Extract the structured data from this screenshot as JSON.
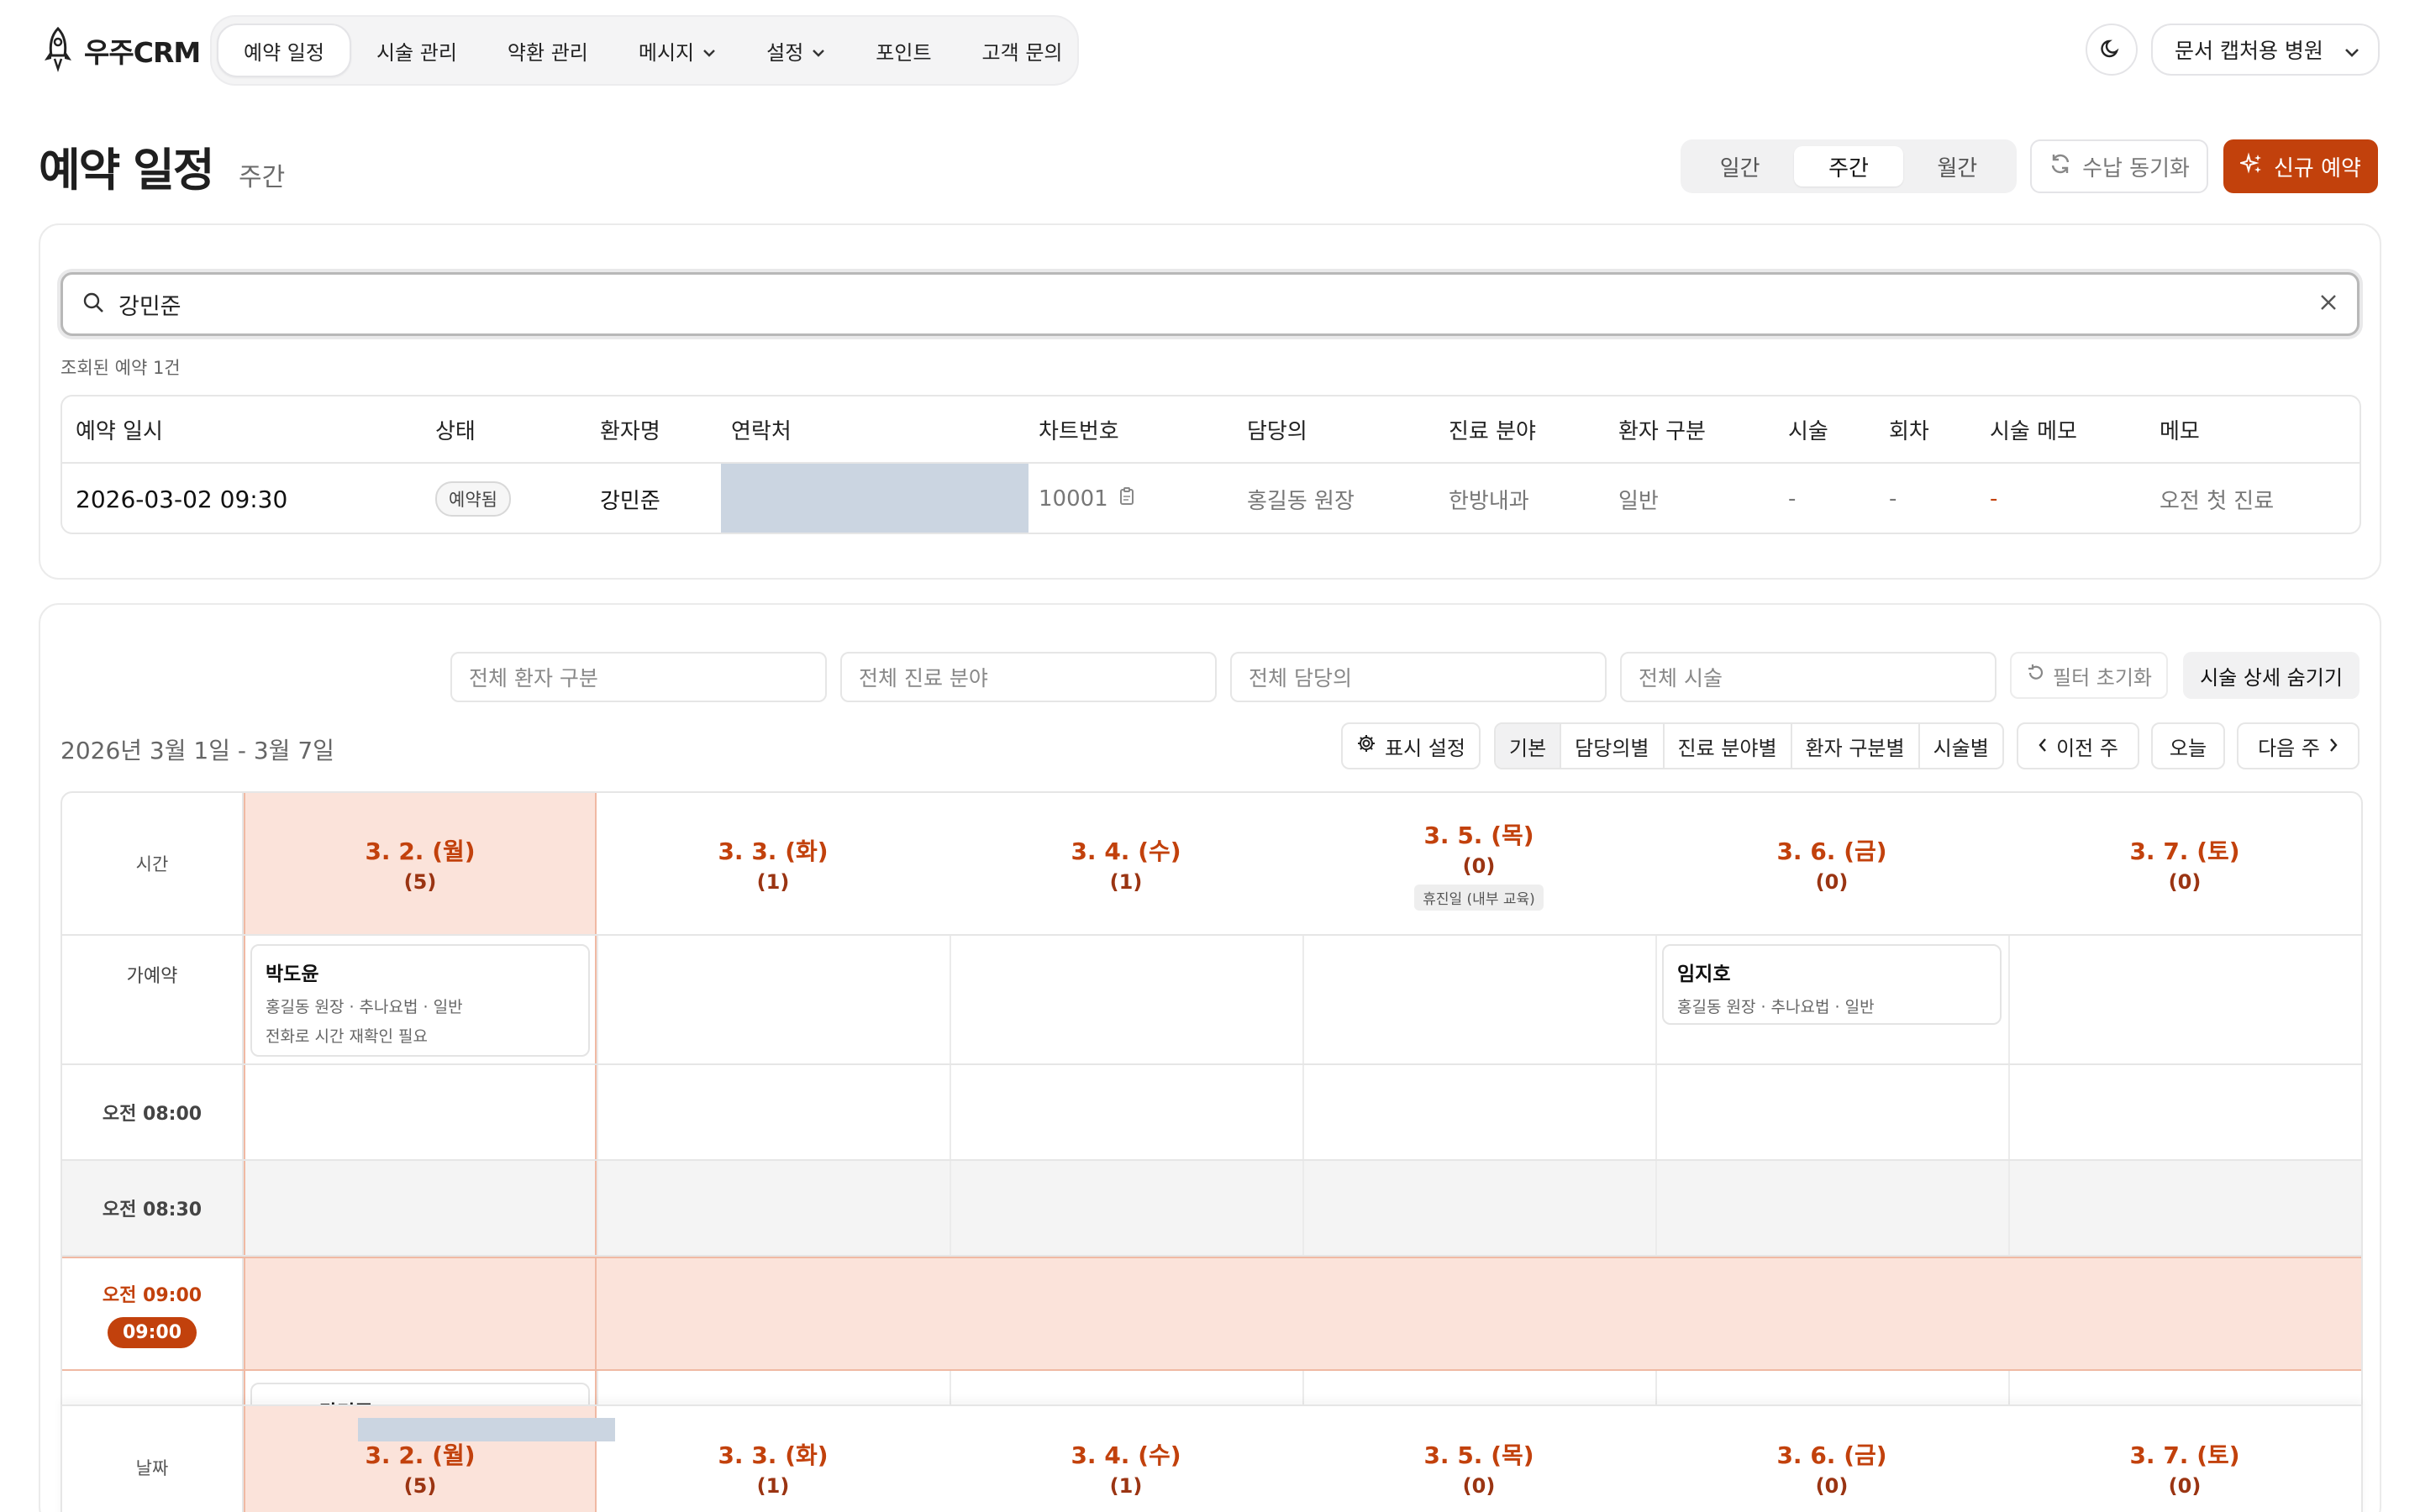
{
  "app": {
    "name": "우주CRM"
  },
  "nav": {
    "items": [
      {
        "label": "예약 일정",
        "active": true,
        "dropdown": false
      },
      {
        "label": "시술 관리",
        "active": false,
        "dropdown": false
      },
      {
        "label": "약환 관리",
        "active": false,
        "dropdown": false
      },
      {
        "label": "메시지",
        "active": false,
        "dropdown": true
      },
      {
        "label": "설정",
        "active": false,
        "dropdown": true
      },
      {
        "label": "포인트",
        "active": false,
        "dropdown": false
      },
      {
        "label": "고객 문의",
        "active": false,
        "dropdown": false
      }
    ],
    "clinic": "문서 캡처용 병원"
  },
  "header": {
    "title": "예약 일정",
    "subtitle": "주간",
    "views": [
      "일간",
      "주간",
      "월간"
    ],
    "active_view": "주간",
    "sync_label": "수납 동기화",
    "new_label": "신규 예약"
  },
  "search": {
    "value": "강민준",
    "result_count": "조회된 예약 1건",
    "columns": [
      "예약 일시",
      "상태",
      "환자명",
      "연락처",
      "차트번호",
      "담당의",
      "진료 분야",
      "환자 구분",
      "시술",
      "회차",
      "시술 메모",
      "메모"
    ],
    "row": {
      "datetime": "2026-03-02 09:30",
      "status": "예약됨",
      "patient": "강민준",
      "chart_no": "10001",
      "doctor": "홍길동 원장",
      "department": "한방내과",
      "patient_type": "일반",
      "procedure": "-",
      "session": "-",
      "procedure_memo": "-",
      "memo": "오전 첫 진료"
    }
  },
  "filters": {
    "patient_type": "전체 환자 구분",
    "department": "전체 진료 분야",
    "doctor": "전체 담당의",
    "procedure": "전체 시술",
    "reset": "필터 초기화",
    "hide_detail": "시술 상세 숨기기"
  },
  "toolbar": {
    "range": "2026년 3월 1일 - 3월 7일",
    "display_settings": "표시 설정",
    "modes": [
      "기본",
      "담당의별",
      "진료 분야별",
      "환자 구분별",
      "시술별"
    ],
    "active_mode": "기본",
    "prev": "이전 주",
    "today": "오늘",
    "next": "다음 주"
  },
  "calendar": {
    "time_header": "시간",
    "days": [
      {
        "date": "3. 2. (월)",
        "count": "(5)",
        "today": true,
        "note": ""
      },
      {
        "date": "3. 3. (화)",
        "count": "(1)",
        "today": false,
        "note": ""
      },
      {
        "date": "3. 4. (수)",
        "count": "(1)",
        "today": false,
        "note": ""
      },
      {
        "date": "3. 5. (목)",
        "count": "(0)",
        "today": false,
        "note": "휴진일 (내부 교육)"
      },
      {
        "date": "3. 6. (금)",
        "count": "(0)",
        "today": false,
        "note": ""
      },
      {
        "date": "3. 7. (토)",
        "count": "(0)",
        "today": false,
        "note": ""
      }
    ],
    "tentative_label": "가예약",
    "tentative": [
      {
        "name": "박도윤",
        "meta": "홍길동 원장 · 추나요법 · 일반",
        "note": "전화로 시간 재확인 필요"
      },
      {
        "name": "임지호",
        "meta": "홍길동 원장 · 추나요법 · 일반",
        "note": ""
      }
    ],
    "slots": [
      "오전 08:00",
      "오전 08:30",
      "오전 09:00"
    ],
    "now_badge": "09:00",
    "partial_name": "강민준",
    "footer_label": "날짜"
  },
  "colors": {
    "accent": "#c2410c",
    "today_bg": "#fbe3da",
    "mask": "#cbd5e1"
  }
}
